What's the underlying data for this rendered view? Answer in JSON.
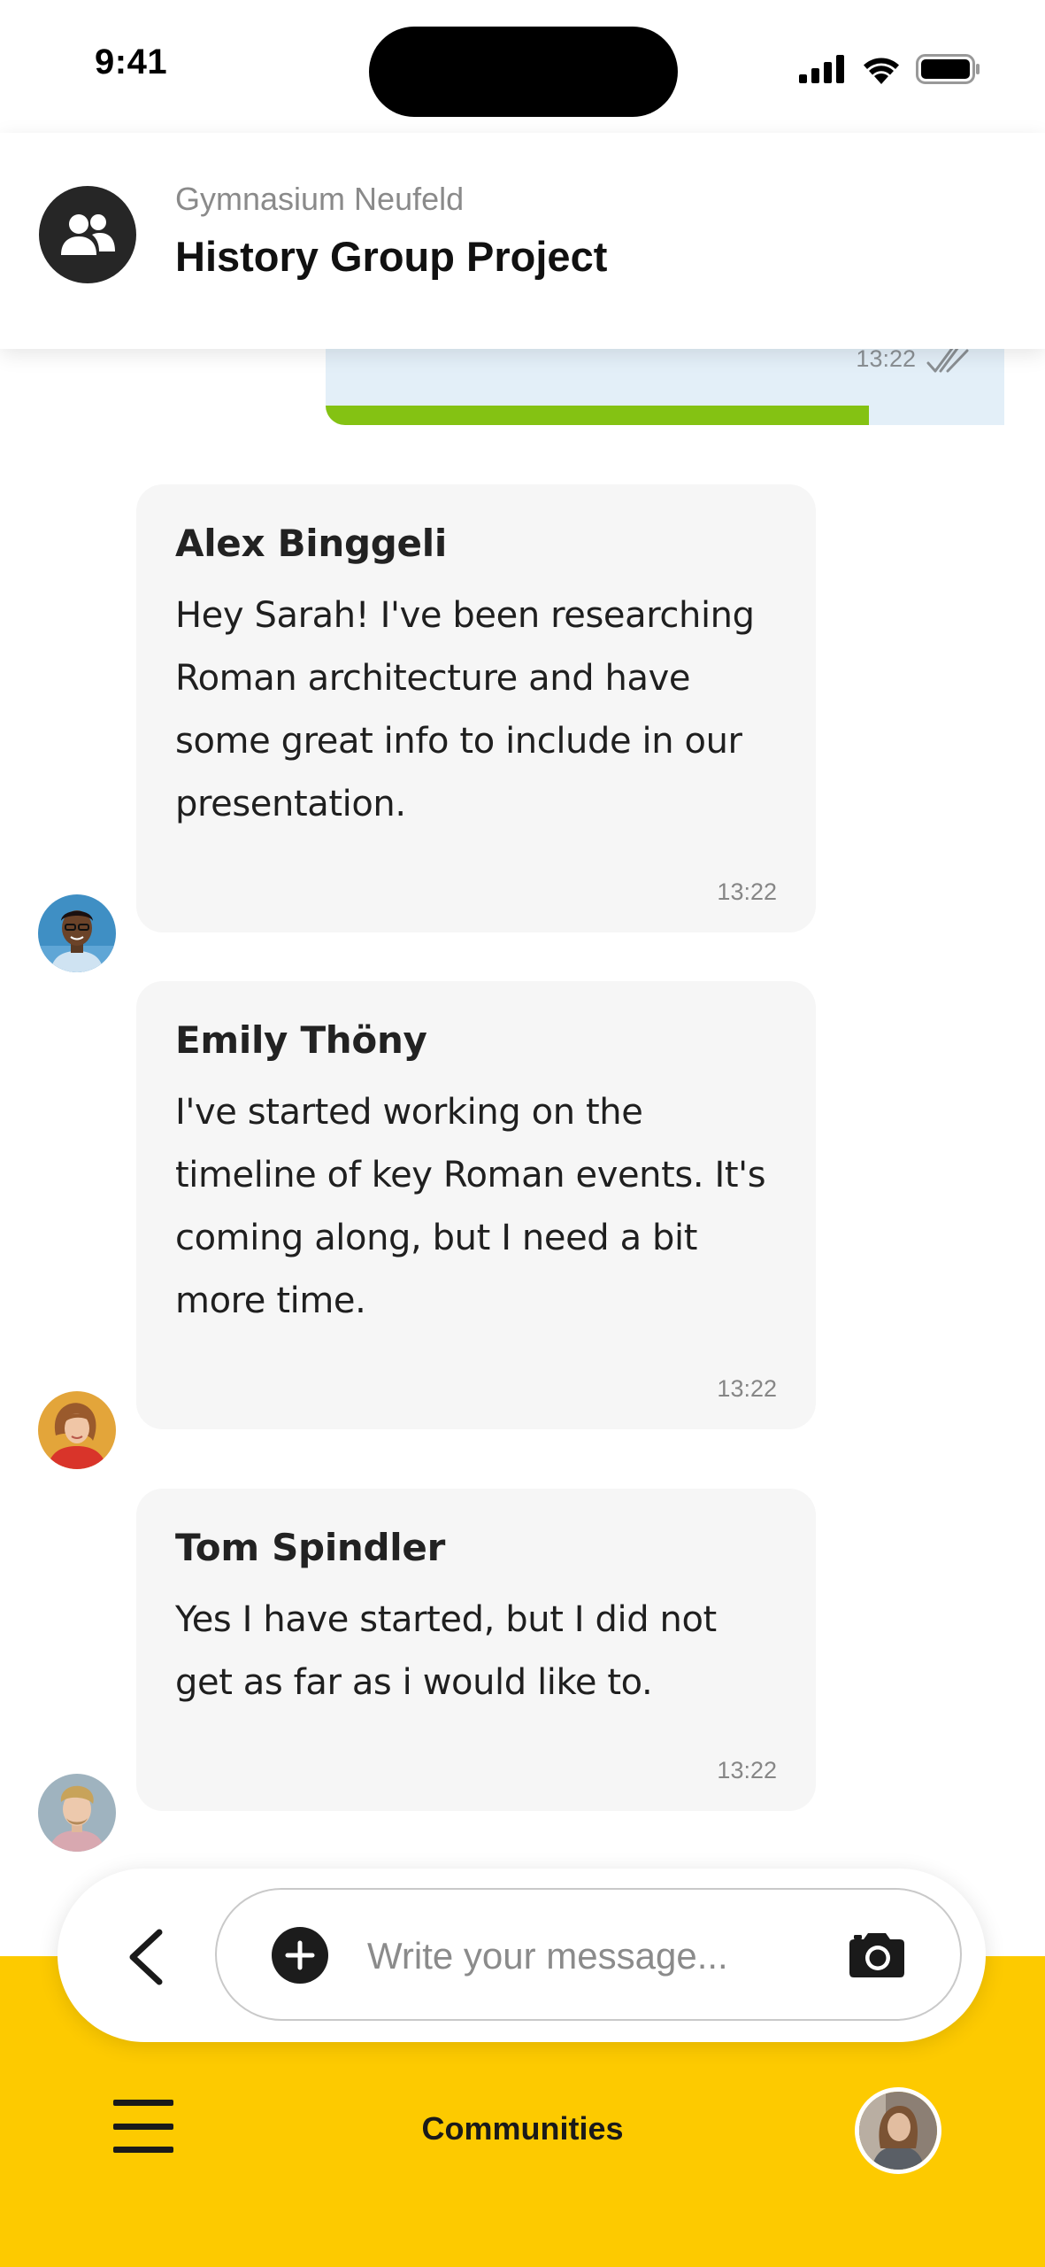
{
  "status_bar": {
    "time": "9:41"
  },
  "header": {
    "subtitle": "Gymnasium Neufeld",
    "title": "History Group Project",
    "avatar_icon": "group-icon"
  },
  "own_message": {
    "time": "13:22",
    "status_icon": "double-check-icon",
    "progress": 0.8
  },
  "messages": [
    {
      "sender": "Alex Binggeli",
      "text": "Hey Sarah! I've been researching Roman architecture and have some great info to include in our presentation.",
      "time": "13:22"
    },
    {
      "sender": "Emily Thöny",
      "text": "I've started working on the timeline of key Roman events. It's coming along, but I need a bit more time.",
      "time": "13:22"
    },
    {
      "sender": "Tom Spindler",
      "text": "Yes I have started, but I did not get as far as i would like to.",
      "time": "13:22"
    }
  ],
  "composer": {
    "placeholder": "Write your message...",
    "value": ""
  },
  "bottom_nav": {
    "title": "Communities"
  },
  "colors": {
    "accent": "#fdca00",
    "progress": "#84c213",
    "own_bubble": "#e3eff8",
    "bubble": "#f6f6f6"
  }
}
